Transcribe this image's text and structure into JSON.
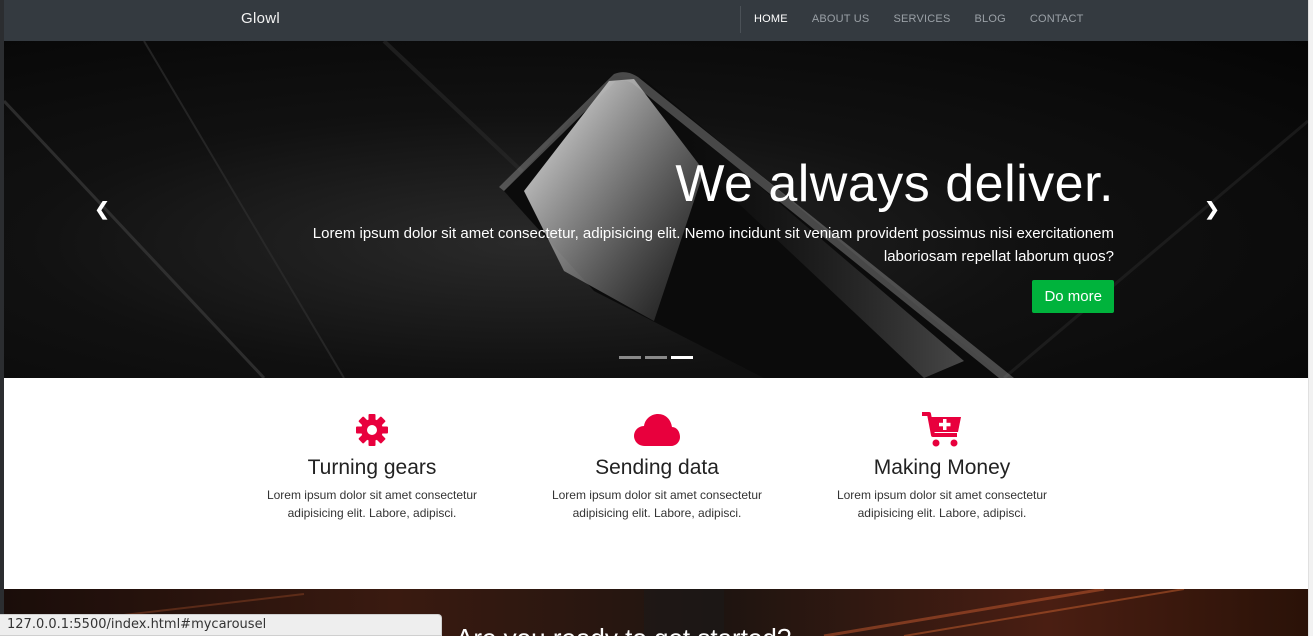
{
  "navbar": {
    "brand": "Glowl",
    "items": [
      {
        "label": "HOME",
        "active": true
      },
      {
        "label": "ABOUT US",
        "active": false
      },
      {
        "label": "SERVICES",
        "active": false
      },
      {
        "label": "BLOG",
        "active": false
      },
      {
        "label": "CONTACT",
        "active": false
      }
    ]
  },
  "carousel": {
    "heading": "We always deliver.",
    "text": "Lorem ipsum dolor sit amet consectetur, adipisicing elit. Nemo incidunt sit veniam provident possimus nisi exercitationem laboriosam repellat laborum quos?",
    "button_label": "Do more",
    "prev_icon": "chevron-left-icon",
    "next_icon": "chevron-right-icon",
    "slide_count": 3,
    "active_slide": 3
  },
  "features": [
    {
      "icon": "gear-icon",
      "title": "Turning gears",
      "text": "Lorem ipsum dolor sit amet consectetur adipisicing elit. Labore, adipisci."
    },
    {
      "icon": "cloud-icon",
      "title": "Sending data",
      "text": "Lorem ipsum dolor sit amet consectetur adipisicing elit. Labore, adipisci."
    },
    {
      "icon": "cart-plus-icon",
      "title": "Making Money",
      "text": "Lorem ipsum dolor sit amet consectetur adipisicing elit. Labore, adipisci."
    }
  ],
  "next_section": {
    "heading": "Are you ready to get started?"
  },
  "status_bar": {
    "url": "127.0.0.1:5500/index.html#mycarousel"
  },
  "colors": {
    "navbar_bg": "#343a40",
    "accent_button": "#00b33c",
    "icon_accent": "#e8003d"
  }
}
